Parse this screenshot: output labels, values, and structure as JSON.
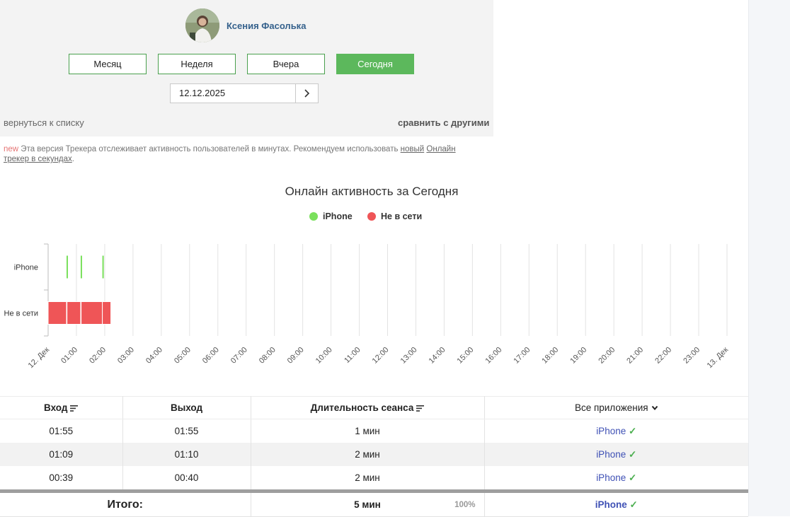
{
  "profile": {
    "name": "Ксения Фасолька"
  },
  "periods": [
    {
      "label": "Месяц",
      "active": false
    },
    {
      "label": "Неделя",
      "active": false
    },
    {
      "label": "Вчера",
      "active": false
    },
    {
      "label": "Сегодня",
      "active": true
    }
  ],
  "date": {
    "value": "12.12.2025"
  },
  "links": {
    "back": "вернуться к списку",
    "compare": "сравнить с другими"
  },
  "notice": {
    "new": "new",
    "text": " Эта версия Трекера отслеживает активность пользователей в минутах. Рекомендуем использовать ",
    "link1": "новый",
    "link2": "Онлайн трекер в секундах",
    "end": "."
  },
  "colors": {
    "online": "#7ae05c",
    "offline": "#ef5557",
    "accent": "#5cb85c",
    "app_link": "#3f51b5"
  },
  "chart_data": {
    "type": "timeline",
    "title": "Онлайн активность за Сегодня",
    "legend": [
      {
        "name": "iPhone",
        "color": "#7ae05c"
      },
      {
        "name": "Не в сети",
        "color": "#ef5557"
      }
    ],
    "categories": [
      "iPhone",
      "Не в сети"
    ],
    "x_ticks": [
      "12. Дек",
      "01:00",
      "02:00",
      "03:00",
      "04:00",
      "05:00",
      "06:00",
      "07:00",
      "08:00",
      "09:00",
      "10:00",
      "11:00",
      "12:00",
      "13:00",
      "14:00",
      "15:00",
      "16:00",
      "17:00",
      "18:00",
      "19:00",
      "20:00",
      "21:00",
      "22:00",
      "23:00",
      "13. Дек"
    ],
    "xlim": [
      "00:00",
      "24:00"
    ],
    "grid": true,
    "series": [
      {
        "name": "iPhone",
        "intervals": [
          [
            "00:39",
            "00:40"
          ],
          [
            "01:09",
            "01:10"
          ],
          [
            "01:55",
            "01:55"
          ]
        ]
      },
      {
        "name": "Не в сети",
        "intervals": [
          [
            "00:00",
            "00:39"
          ],
          [
            "00:40",
            "01:09"
          ],
          [
            "01:10",
            "01:55"
          ],
          [
            "01:55",
            "02:13"
          ]
        ]
      }
    ]
  },
  "table": {
    "headers": {
      "start": "Вход",
      "end": "Выход",
      "duration": "Длительность сеанса",
      "apps": "Все приложения"
    },
    "rows": [
      {
        "start": "01:55",
        "end": "01:55",
        "duration": "1 мин",
        "app": "iPhone"
      },
      {
        "start": "01:09",
        "end": "01:10",
        "duration": "2 мин",
        "app": "iPhone"
      },
      {
        "start": "00:39",
        "end": "00:40",
        "duration": "2 мин",
        "app": "iPhone"
      }
    ],
    "total": {
      "label": "Итого:",
      "duration": "5 мин",
      "percent": "100%",
      "app": "iPhone"
    }
  }
}
